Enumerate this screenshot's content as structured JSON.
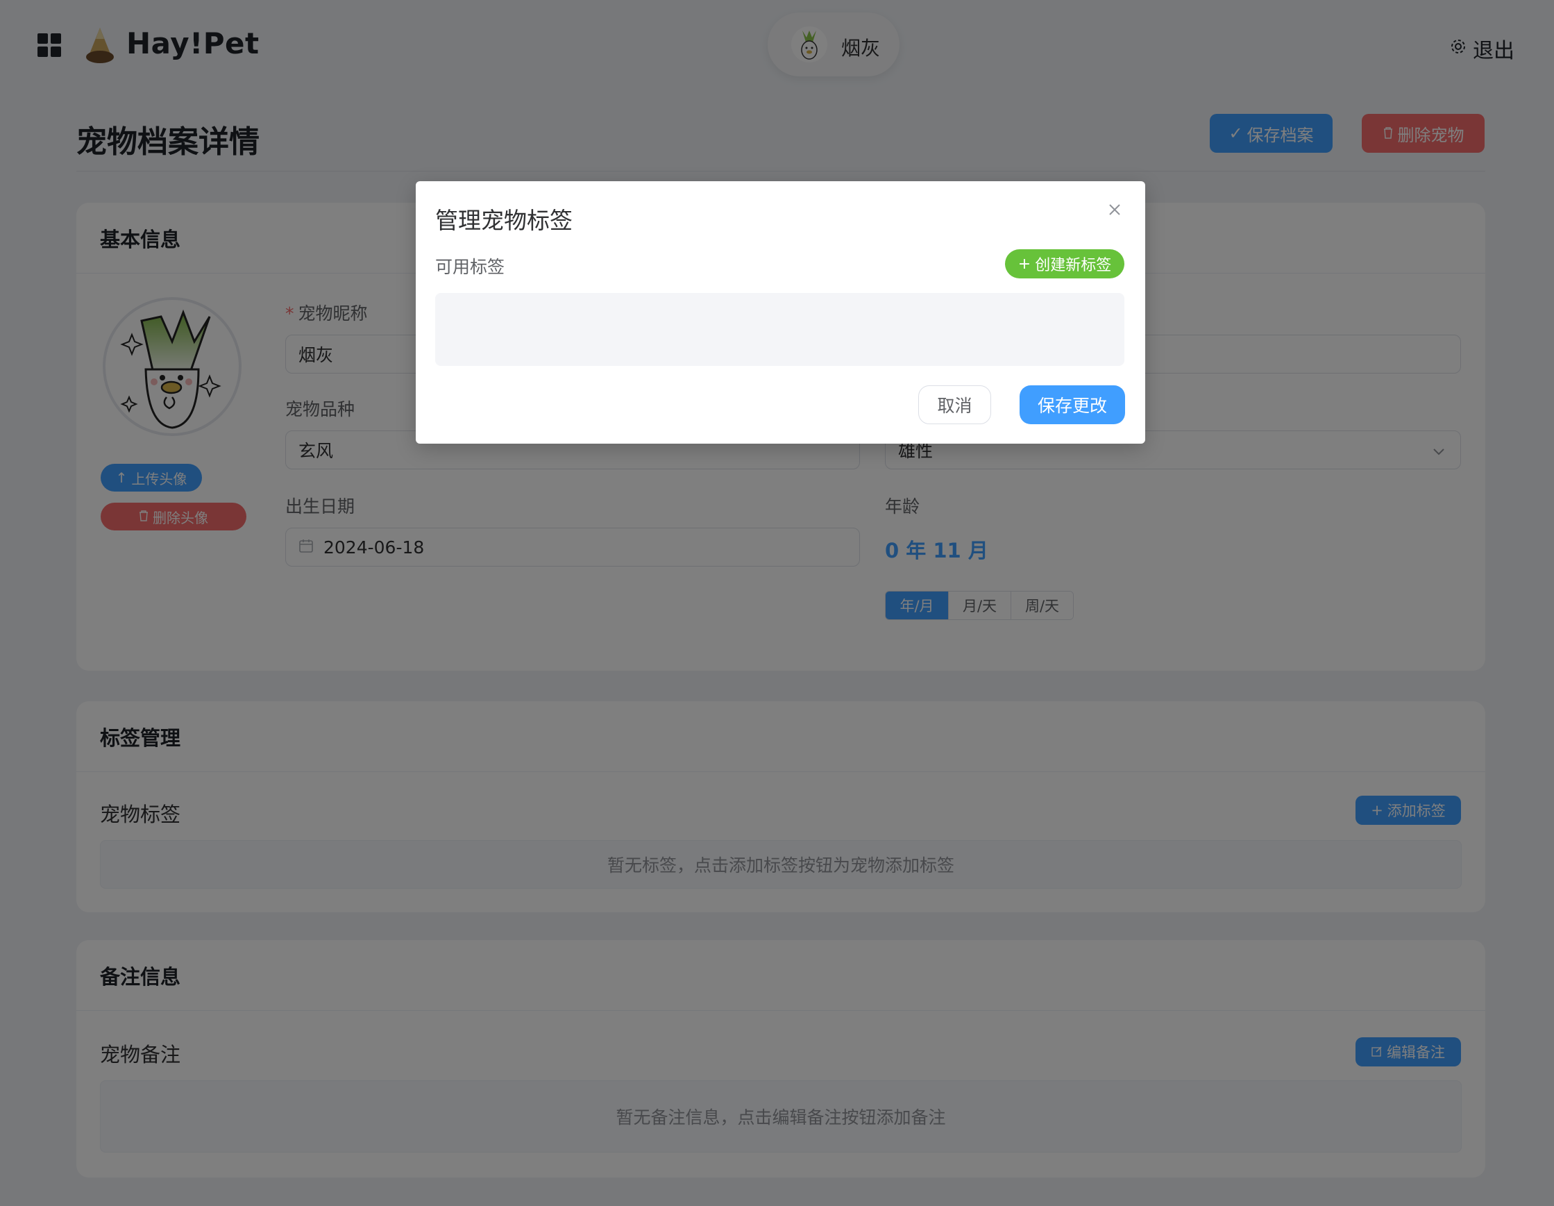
{
  "header": {
    "brand": "Hay!Pet",
    "current_pet": "烟灰",
    "logout_label": "退出"
  },
  "page": {
    "title": "宠物档案详情",
    "save_profile_label": "保存档案",
    "delete_pet_label": "删除宠物"
  },
  "basic_info": {
    "section_title": "基本信息",
    "upload_avatar_label": "上传头像",
    "remove_avatar_label": "删除头像",
    "nickname_label": "宠物昵称",
    "nickname_value": "烟灰",
    "breed_label": "宠物品种",
    "breed_value": "玄风",
    "gender_value": "雄性",
    "birthdate_label": "出生日期",
    "birthdate_value": "2024-06-18",
    "age_label": "年龄",
    "age_value": "0 年 11 月",
    "age_formats": [
      "年/月",
      "月/天",
      "周/天"
    ],
    "age_format_selected": "年/月"
  },
  "tags": {
    "section_title": "标签管理",
    "label": "宠物标签",
    "add_tag_label": "添加标签",
    "empty_text": "暂无标签，点击添加标签按钮为宠物添加标签"
  },
  "notes": {
    "section_title": "备注信息",
    "label": "宠物备注",
    "edit_note_label": "编辑备注",
    "empty_text": "暂无备注信息，点击编辑备注按钮添加备注"
  },
  "dialog": {
    "title": "管理宠物标签",
    "available_tags_label": "可用标签",
    "create_tag_label": "创建新标签",
    "cancel_label": "取消",
    "save_changes_label": "保存更改"
  },
  "colors": {
    "primary": "#409eff",
    "danger": "#f56c6c",
    "success": "#67c23a"
  }
}
